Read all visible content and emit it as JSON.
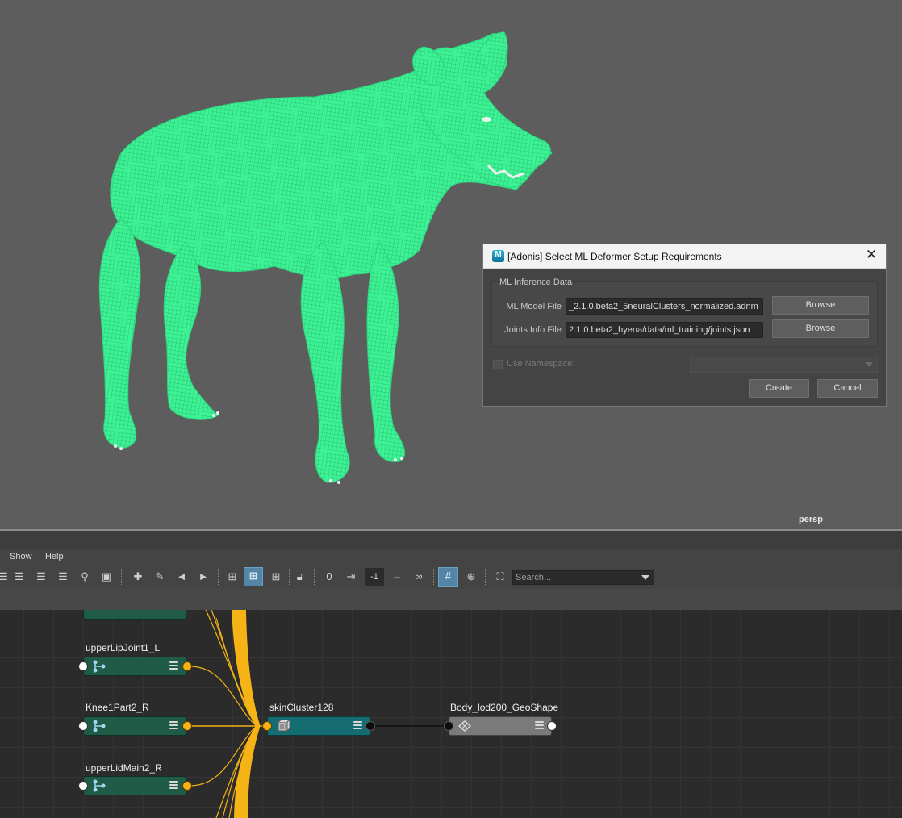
{
  "viewport": {
    "camera_label": "persp",
    "wireframe_color": "#3cf294"
  },
  "dialog": {
    "title": "[Adonis] Select ML Deformer Setup Requirements",
    "group_title": "ML Inference Data",
    "ml_model": {
      "label": "ML Model File",
      "value": "_2.1.0.beta2_5neuralClusters_normalized.adnm",
      "browse": "Browse"
    },
    "joints_info": {
      "label": "Joints Info File",
      "value": "2.1.0.beta2_hyena/data/ml_training/joints.json",
      "browse": "Browse"
    },
    "namespace_label": "Use Namespace:",
    "create": "Create",
    "cancel": "Cancel"
  },
  "node_editor": {
    "menu": [
      "Show",
      "Help"
    ],
    "num_field": "-1",
    "search_placeholder": "Search...",
    "nodes": {
      "upperLipJoint1_L": "upperLipJoint1_L",
      "Knee1Part2_R": "Knee1Part2_R",
      "upperLidMain2_R": "upperLidMain2_R",
      "skinCluster128": "skinCluster128",
      "Body_lod200_GeoShape": "Body_lod200_GeoShape"
    },
    "colors": {
      "joint_node": "#1f5b47",
      "cluster_node": "#156d72",
      "shape_node": "#7a7a7a",
      "connection": "#f5b316"
    }
  }
}
